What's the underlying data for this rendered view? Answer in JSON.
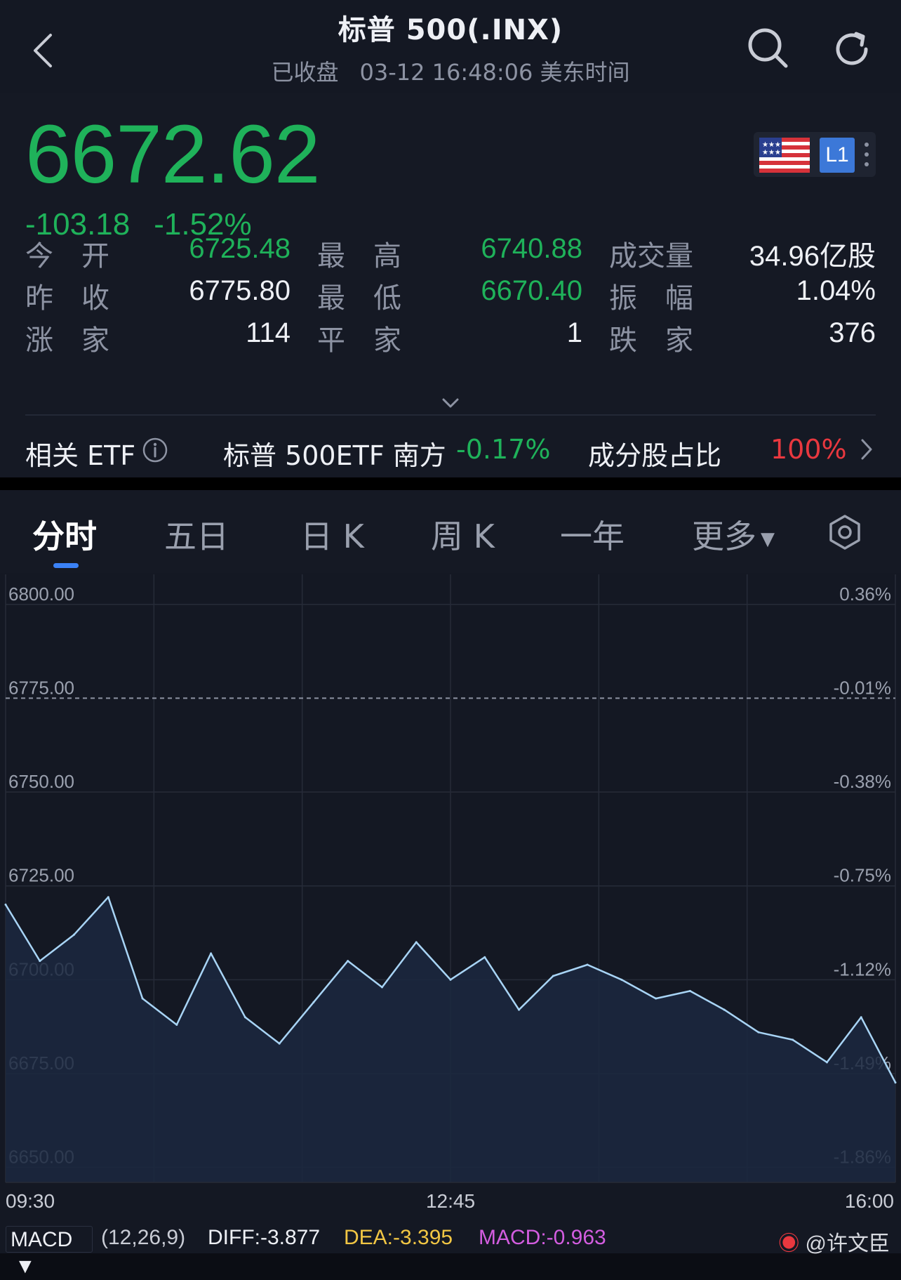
{
  "header": {
    "title": "标普 500(.INX)",
    "status": "已收盘",
    "timestamp": "03-12 16:48:06 美东时间"
  },
  "quote": {
    "price": "6672.62",
    "change": "-103.18",
    "change_pct": "-1.52%",
    "level_badge": "L1",
    "stats": {
      "row1": [
        {
          "label": "今　开",
          "value": "6725.48",
          "tone": "green"
        },
        {
          "label": "最　高",
          "value": "6740.88",
          "tone": "green"
        },
        {
          "label": "成交量",
          "value": "34.96亿股",
          "tone": "white"
        }
      ],
      "row2": [
        {
          "label": "昨　收",
          "value": "6775.80",
          "tone": "white"
        },
        {
          "label": "最　低",
          "value": "6670.40",
          "tone": "green"
        },
        {
          "label": "振　幅",
          "value": "1.04%",
          "tone": "white"
        }
      ],
      "row3": [
        {
          "label": "涨　家",
          "value": "114",
          "tone": "white"
        },
        {
          "label": "平　家",
          "value": "1",
          "tone": "white"
        },
        {
          "label": "跌　家",
          "value": "376",
          "tone": "white"
        }
      ]
    }
  },
  "etf": {
    "label": "相关 ETF",
    "fund_name": "标普 500ETF 南方",
    "fund_change": "-0.17%",
    "weight_label": "成分股占比",
    "weight_value": "100%"
  },
  "tabs": [
    "分时",
    "五日",
    "日 K",
    "周 K",
    "一年",
    "更多"
  ],
  "chart_data": {
    "type": "line",
    "y_left_ticks": [
      "6800.00",
      "6775.00",
      "6750.00",
      "6725.00",
      "6700.00",
      "6675.00",
      "6650.00"
    ],
    "y_right_ticks": [
      "0.36%",
      "-0.01%",
      "-0.38%",
      "-0.75%",
      "-1.12%",
      "-1.49%",
      "-1.86%"
    ],
    "x_ticks": [
      "09:30",
      "12:45",
      "16:00"
    ],
    "ylim": [
      6646,
      6808
    ],
    "prev_close": 6775.8,
    "x": [
      "09:30",
      "09:45",
      "10:00",
      "10:15",
      "10:30",
      "10:45",
      "11:00",
      "11:15",
      "11:30",
      "11:45",
      "12:00",
      "12:15",
      "12:30",
      "12:45",
      "13:00",
      "13:15",
      "13:30",
      "13:45",
      "14:00",
      "14:15",
      "14:30",
      "14:45",
      "15:00",
      "15:15",
      "15:30",
      "15:45",
      "16:00"
    ],
    "values": [
      6720,
      6705,
      6712,
      6722,
      6695,
      6688,
      6707,
      6690,
      6683,
      6694,
      6705,
      6698,
      6710,
      6700,
      6706,
      6692,
      6701,
      6704,
      6700,
      6695,
      6697,
      6692,
      6686,
      6684,
      6678,
      6690,
      6672.62
    ],
    "line_color": "#a8d4f5"
  },
  "macd": {
    "selector": "MACD",
    "params": "(12,26,9)",
    "diff": "DIFF:-3.877",
    "dea": "DEA:-3.395",
    "macd": "MACD:-0.963"
  },
  "watermark": "@许文臣"
}
